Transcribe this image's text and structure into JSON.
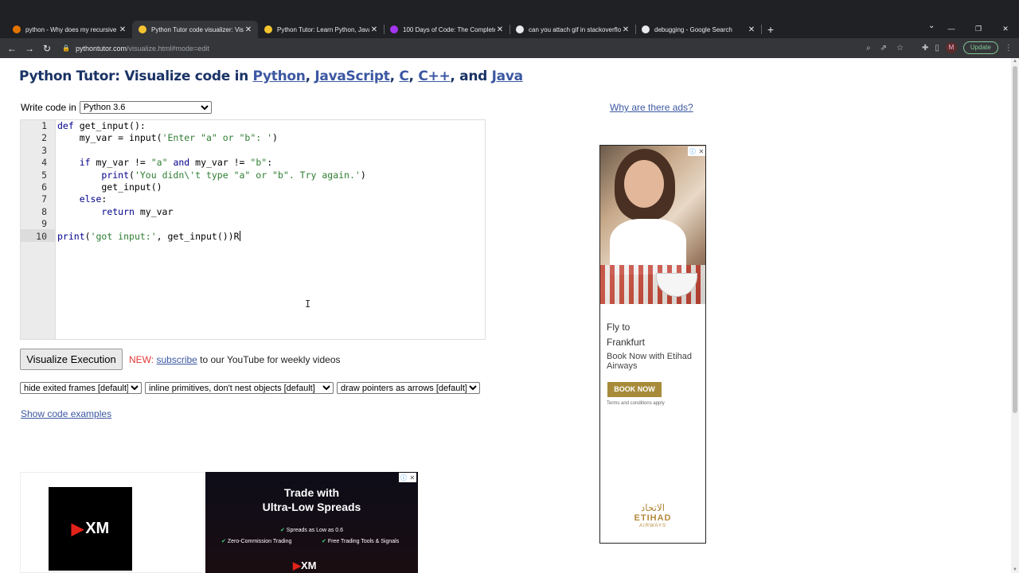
{
  "browser": {
    "tabs": [
      {
        "title": "python - Why does my recursive",
        "color": "#e37400",
        "active": false
      },
      {
        "title": "Python Tutor code visualizer: Vis",
        "color": "#f4c430",
        "active": true
      },
      {
        "title": "Python Tutor: Learn Python, Java",
        "color": "#f4c430",
        "active": false
      },
      {
        "title": "100 Days of Code: The Complete",
        "color": "#a435f0",
        "active": false
      },
      {
        "title": "can you attach gif in stackoverflo",
        "color": "#e8eaed",
        "active": false
      },
      {
        "title": "debugging - Google Search",
        "color": "#e8eaed",
        "active": false
      }
    ],
    "url_host": "pythontutor.com",
    "url_path": "/visualize.html#mode=edit",
    "avatar_letter": "M",
    "update_label": "Update"
  },
  "page": {
    "title_prefix": "Python Tutor: Visualize code in ",
    "langs": [
      "Python",
      "JavaScript",
      "C",
      "C++",
      "Java"
    ],
    "sep_comma": ", ",
    "sep_and": ", and ",
    "write_label": "Write code in",
    "lang_selected": "Python 3.6",
    "why_ads": "Why are there ads?",
    "visualize_label": "Visualize Execution",
    "new_label": "NEW:",
    "subscribe_label": "subscribe",
    "news_rest": " to our YouTube for weekly videos",
    "opt_frames": "hide exited frames [default]",
    "opt_primitives": "inline primitives, don't nest objects [default]",
    "opt_pointers": "draw pointers as arrows [default]",
    "examples_label": "Show code examples",
    "line_numbers": [
      "1",
      "2",
      "3",
      "4",
      "5",
      "6",
      "7",
      "8",
      "9",
      "10"
    ]
  },
  "ads": {
    "side": {
      "fly_to": "Fly to",
      "destination": "Frankfurt",
      "book_text": "Book Now with Etihad Airways",
      "button": "BOOK NOW",
      "terms": "Terms and conditions apply",
      "brand_ar": "الاتحاد",
      "brand": "ETIHAD",
      "brand_sub": "AIRWAYS"
    },
    "bottom": {
      "logo": "XM",
      "headline1": "Trade with",
      "headline2": "Ultra-Low Spreads",
      "bullet1": "Spreads as Low as 0.6",
      "bullet2": "Zero-Commission Trading",
      "bullet3": "Free Trading Tools & Signals"
    }
  }
}
